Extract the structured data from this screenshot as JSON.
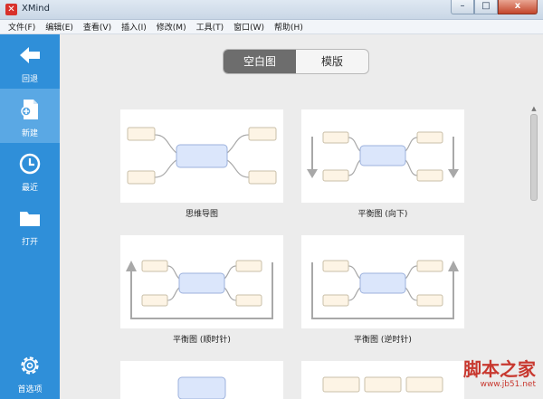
{
  "window": {
    "title": "XMind",
    "controls": [
      "–",
      "□",
      "x"
    ]
  },
  "menu": [
    "文件(F)",
    "编辑(E)",
    "查看(V)",
    "插入(I)",
    "修改(M)",
    "工具(T)",
    "窗口(W)",
    "帮助(H)"
  ],
  "sidebar": {
    "items": [
      {
        "label": "回退",
        "icon": "back-arrow-icon"
      },
      {
        "label": "新建",
        "icon": "new-file-icon"
      },
      {
        "label": "最近",
        "icon": "clock-icon"
      },
      {
        "label": "打开",
        "icon": "folder-icon"
      }
    ],
    "bottom": {
      "label": "首选项",
      "icon": "gear-icon"
    }
  },
  "tabs": {
    "blank": "空白图",
    "template": "模版",
    "active": "blank"
  },
  "templates": [
    {
      "caption": "思维导图"
    },
    {
      "caption": "平衡图 (向下)"
    },
    {
      "caption": "平衡图 (顺时针)"
    },
    {
      "caption": "平衡图 (逆时针)"
    }
  ],
  "watermark": {
    "site_top": "脚本之家",
    "site_bottom": "www.jb51.net"
  },
  "colors": {
    "sidebar": "#2f8fd9",
    "sidebar_active": "#5aa8e4",
    "central_topic": "#dbe6fb",
    "subtopic": "#fdf4e5"
  }
}
